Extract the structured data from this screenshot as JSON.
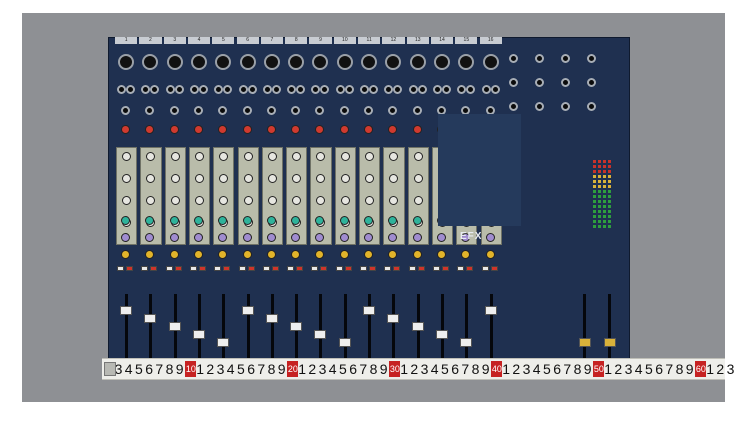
{
  "photo": {
    "subject": "audio mixing console with measuring tape",
    "brand_mark": "EFX",
    "channel_numbers": [
      "1",
      "2",
      "3",
      "4",
      "5",
      "6",
      "7",
      "8",
      "9",
      "10",
      "11",
      "12",
      "13",
      "14",
      "15",
      "16"
    ]
  },
  "ruler": {
    "digits": [
      "3",
      "4",
      "5",
      "6",
      "7",
      "8",
      "9",
      "10",
      "1",
      "2",
      "3",
      "4",
      "5",
      "6",
      "7",
      "8",
      "9",
      "20",
      "1",
      "2",
      "3",
      "4",
      "5",
      "6",
      "7",
      "8",
      "9",
      "30",
      "1",
      "2",
      "3",
      "4",
      "5",
      "6",
      "7",
      "8",
      "9",
      "40",
      "1",
      "2",
      "3",
      "4",
      "5",
      "6",
      "7",
      "8",
      "9",
      "50",
      "1",
      "2",
      "3",
      "4",
      "5",
      "6",
      "7",
      "8",
      "9",
      "60",
      "1",
      "2",
      "3"
    ],
    "red_marks": [
      "10",
      "20",
      "30",
      "40",
      "50",
      "60"
    ]
  },
  "colors": {
    "panel": "#1f3050",
    "eq_panel": "#b9bcaa",
    "gain_knob": "#d03a2f",
    "mid_knob": "#2fb39b",
    "aux_knob": "#a08cd0",
    "pan_knob": "#e2b42a",
    "ruler_red": "#c62222"
  }
}
